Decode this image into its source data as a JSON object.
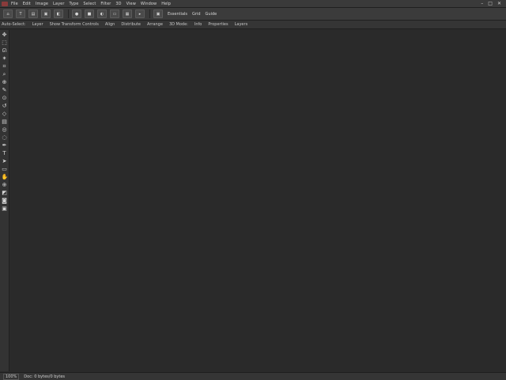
{
  "titlebar": {
    "menus": [
      "File",
      "Edit",
      "Image",
      "Layer",
      "Type",
      "Select",
      "Filter",
      "3D",
      "View",
      "Window",
      "Help"
    ],
    "window_controls": [
      "–",
      "□",
      "✕"
    ]
  },
  "toolbar": {
    "buttons": [
      "⌂",
      "T",
      "▤",
      "▣",
      "◧",
      "●",
      "■",
      "◐",
      "▭",
      "▦",
      "▸",
      "▣"
    ],
    "workspace_tabs": [
      "Essentials",
      "Grid",
      "Guide"
    ]
  },
  "options_bar": {
    "items": [
      "Auto-Select:",
      "Layer",
      "Show Transform Controls",
      "Align",
      "Distribute",
      "Arrange",
      "3D Mode:",
      "Info",
      "Properties",
      "Layers"
    ]
  },
  "tools": [
    {
      "icon": "move-icon",
      "glyph": "✥"
    },
    {
      "icon": "marquee-icon",
      "glyph": "⬚"
    },
    {
      "icon": "lasso-icon",
      "glyph": "ᘏ"
    },
    {
      "icon": "magic-wand-icon",
      "glyph": "✶"
    },
    {
      "icon": "crop-icon",
      "glyph": "⌗"
    },
    {
      "icon": "eyedropper-icon",
      "glyph": "⌕"
    },
    {
      "icon": "healing-icon",
      "glyph": "⊕"
    },
    {
      "icon": "brush-icon",
      "glyph": "✎"
    },
    {
      "icon": "stamp-icon",
      "glyph": "⊙"
    },
    {
      "icon": "history-brush-icon",
      "glyph": "↺"
    },
    {
      "icon": "eraser-icon",
      "glyph": "◇"
    },
    {
      "icon": "gradient-icon",
      "glyph": "▤"
    },
    {
      "icon": "blur-icon",
      "glyph": "◎"
    },
    {
      "icon": "dodge-icon",
      "glyph": "◌"
    },
    {
      "icon": "pen-icon",
      "glyph": "✒"
    },
    {
      "icon": "type-icon",
      "glyph": "T"
    },
    {
      "icon": "path-select-icon",
      "glyph": "➤"
    },
    {
      "icon": "shape-icon",
      "glyph": "▭"
    },
    {
      "icon": "hand-icon",
      "glyph": "✋"
    },
    {
      "icon": "zoom-icon",
      "glyph": "⊕"
    },
    {
      "icon": "colors-icon",
      "glyph": "◩"
    },
    {
      "icon": "quick-mask-icon",
      "glyph": "◙"
    },
    {
      "icon": "screen-mode-icon",
      "glyph": "▣"
    }
  ],
  "statusbar": {
    "zoom": "100%",
    "doc_info": "Doc: 0 bytes/0 bytes"
  }
}
